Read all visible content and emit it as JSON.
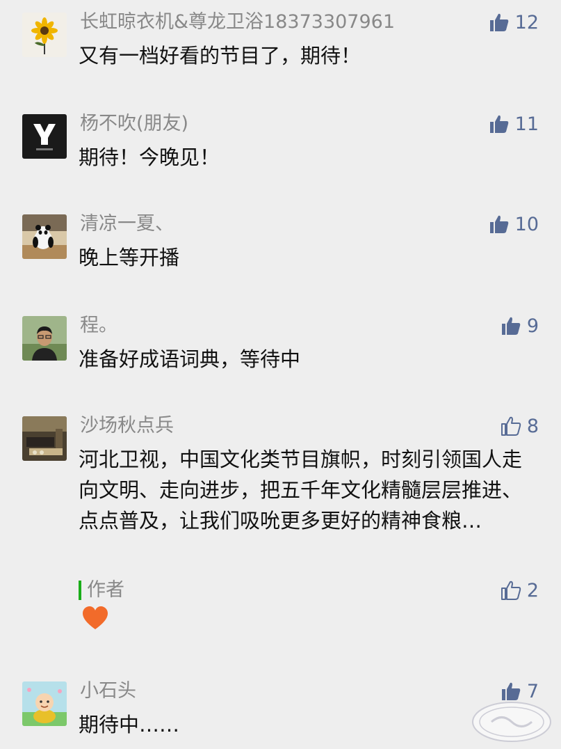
{
  "comments": [
    {
      "nickname": "长虹晾衣机&尊龙卫浴18373307961",
      "text": "又有一档好看的节目了，期待！",
      "likes": "12",
      "liked": true,
      "avatar": "sunflower-avatar"
    },
    {
      "nickname": "杨不吹(朋友)",
      "text": "期待！今晚见！",
      "likes": "11",
      "liked": true,
      "avatar": "y-logo-avatar"
    },
    {
      "nickname": "清凉一夏、",
      "text": "晚上等开播",
      "likes": "10",
      "liked": true,
      "avatar": "panda-avatar"
    },
    {
      "nickname": "程。",
      "text": "准备好成语词典，等待中",
      "likes": "9",
      "liked": true,
      "avatar": "portrait-avatar"
    },
    {
      "nickname": "沙场秋点兵",
      "text": "河北卫视，中国文化类节目旗帜，时刻引领国人走向文明、走向进步，把五千年文化精髓层层推进、点点普及，让我们吸吮更多更好的精神食粮…",
      "likes": "8",
      "liked": false,
      "avatar": "room-avatar"
    },
    {
      "nickname": "小石头",
      "text": "期待中……",
      "likes": "7",
      "liked": true,
      "avatar": "monk-cartoon-avatar"
    }
  ],
  "author_reply": {
    "label": "作者",
    "likes": "2",
    "liked": false,
    "content_icon": "heart-emoji"
  },
  "watermark": {
    "icon": "seal-watermark"
  },
  "colors": {
    "like_blue": "#576b95",
    "author_bar": "#1aad19",
    "background": "#eeeeee"
  }
}
